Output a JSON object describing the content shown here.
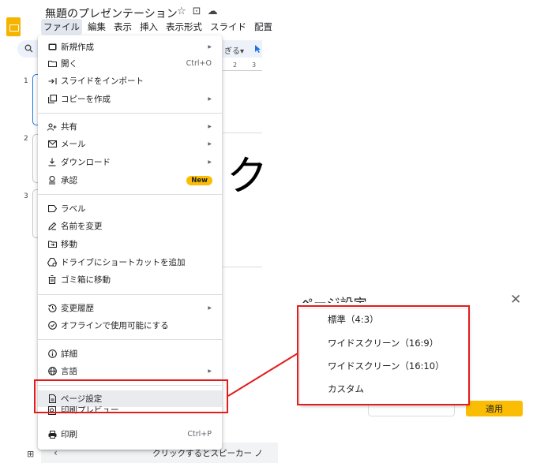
{
  "app": {
    "doc_title": "無題のプレゼンテーション",
    "title_icons": [
      "star-icon",
      "move-to-folder-icon",
      "cloud-status-icon"
    ],
    "brand_color": "#f4b400"
  },
  "menubar": {
    "items": [
      "ファイル",
      "編集",
      "表示",
      "挿入",
      "表示形式",
      "スライド",
      "配置"
    ],
    "active_index": 0
  },
  "toolbar": {
    "partial_text": "ぎる",
    "cursor_glyph": "▾"
  },
  "ruler": {
    "labels": [
      "2",
      "3"
    ]
  },
  "slides": {
    "numbers": [
      "1",
      "2",
      "3"
    ],
    "selected_index": 0,
    "visible_glyph": "ク"
  },
  "file_menu": {
    "items": [
      {
        "label": "新規作成",
        "icon": "new-slide-icon",
        "submenu": true
      },
      {
        "label": "開く",
        "icon": "open-folder-icon",
        "shortcut": "Ctrl+O"
      },
      {
        "label": "スライドをインポート",
        "icon": "import-icon"
      },
      {
        "label": "コピーを作成",
        "icon": "copy-icon",
        "submenu": true
      },
      {
        "label": "共有",
        "icon": "share-person-icon",
        "submenu": true
      },
      {
        "label": "メール",
        "icon": "mail-icon",
        "submenu": true
      },
      {
        "label": "ダウンロード",
        "icon": "download-icon",
        "submenu": true
      },
      {
        "label": "承認",
        "icon": "approval-icon",
        "badge": "New"
      },
      {
        "label": "ラベル",
        "icon": "label-icon"
      },
      {
        "label": "名前を変更",
        "icon": "rename-pencil-icon"
      },
      {
        "label": "移動",
        "icon": "move-folder-icon"
      },
      {
        "label": "ドライブにショートカットを追加",
        "icon": "drive-shortcut-icon"
      },
      {
        "label": "ゴミ箱に移動",
        "icon": "trash-icon"
      },
      {
        "label": "変更履歴",
        "icon": "history-icon",
        "submenu": true
      },
      {
        "label": "オフラインで使用可能にする",
        "icon": "offline-icon"
      },
      {
        "label": "詳細",
        "icon": "info-icon"
      },
      {
        "label": "言語",
        "icon": "globe-icon",
        "submenu": true
      },
      {
        "label": "ページ設定",
        "icon": "page-setup-icon",
        "highlighted": true
      },
      {
        "label": "印刷プレビュー",
        "icon": "print-preview-icon"
      },
      {
        "label": "印刷",
        "icon": "print-icon",
        "shortcut": "Ctrl+P"
      }
    ]
  },
  "page_settings_dialog": {
    "title": "ページ設定",
    "size_options": [
      "標準（4:3）",
      "ワイドスクリーン（16:9）",
      "ワイドスクリーン（16:10）",
      "カスタム"
    ],
    "apply_label": "適用",
    "apply_color": "#fbbc04"
  },
  "speaker_notes": {
    "placeholder": "クリックするとスピーカー ノ"
  },
  "annotation_color": "#e51c1c"
}
